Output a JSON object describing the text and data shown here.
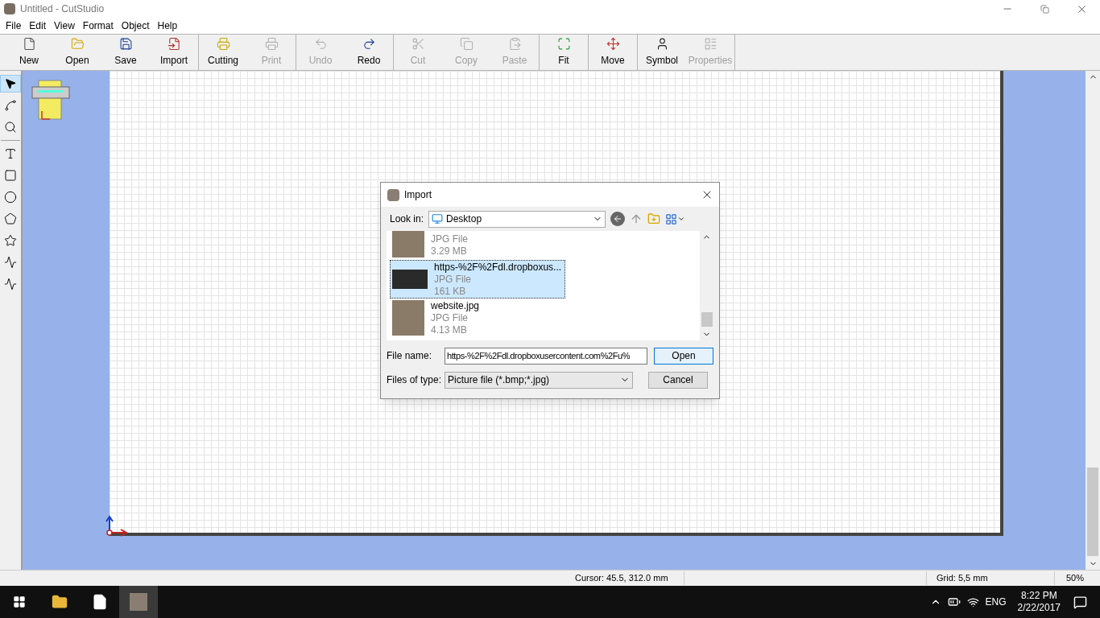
{
  "window": {
    "title": "Untitled - CutStudio"
  },
  "menu": [
    "File",
    "Edit",
    "View",
    "Format",
    "Object",
    "Help"
  ],
  "toolbar_groups": [
    [
      {
        "label": "New",
        "disabled": false
      },
      {
        "label": "Open",
        "disabled": false
      },
      {
        "label": "Save",
        "disabled": false
      },
      {
        "label": "Import",
        "disabled": false
      }
    ],
    [
      {
        "label": "Cutting",
        "disabled": false
      },
      {
        "label": "Print",
        "disabled": true
      }
    ],
    [
      {
        "label": "Undo",
        "disabled": true
      },
      {
        "label": "Redo",
        "disabled": false
      }
    ],
    [
      {
        "label": "Cut",
        "disabled": true
      },
      {
        "label": "Copy",
        "disabled": true
      },
      {
        "label": "Paste",
        "disabled": true
      }
    ],
    [
      {
        "label": "Fit",
        "disabled": false
      }
    ],
    [
      {
        "label": "Move",
        "disabled": false
      }
    ],
    [
      {
        "label": "Symbol",
        "disabled": false
      },
      {
        "label": "Properties",
        "disabled": true
      }
    ]
  ],
  "tools": [
    {
      "kind": "select",
      "selected": true
    },
    {
      "kind": "node",
      "selected": false
    },
    {
      "kind": "zoom",
      "selected": false
    },
    {
      "kind": "text",
      "selected": false
    },
    {
      "kind": "rectangle",
      "selected": false
    },
    {
      "kind": "ellipse",
      "selected": false
    },
    {
      "kind": "polygon",
      "selected": false
    },
    {
      "kind": "star",
      "selected": false
    },
    {
      "kind": "polyline",
      "selected": false
    },
    {
      "kind": "curve",
      "selected": false
    }
  ],
  "dialog": {
    "title": "Import",
    "look_in_label": "Look in:",
    "look_in": "Desktop",
    "files": [
      {
        "type": "JPG File",
        "size": "3.29 MB",
        "selected": false
      },
      {
        "name": "https-%2F%2Fdl.dropboxus...",
        "type": "JPG File",
        "size": "161 KB",
        "selected": true
      },
      {
        "name": "website.jpg",
        "type": "JPG File",
        "size": "4.13 MB",
        "selected": false
      }
    ],
    "file_name_label": "File name:",
    "file_name": "https-%2F%2Fdl.dropboxusercontent.com%2Fu%",
    "file_type_label": "Files of type:",
    "file_type": "Picture file (*.bmp;*.jpg)",
    "buttons": [
      "Open",
      "Cancel"
    ]
  },
  "status_bar": {
    "cursor": "Cursor: 45.5, 312.0 mm",
    "grid": "Grid: 5,5 mm",
    "zoom": "50%"
  },
  "taskbar": {
    "language": "ENG",
    "time": "8:22 PM",
    "date": "2/22/2017"
  }
}
